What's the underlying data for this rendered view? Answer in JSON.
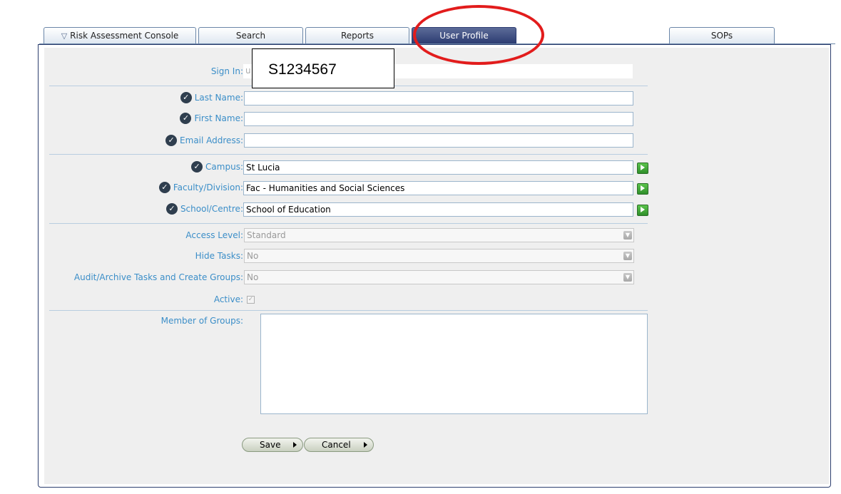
{
  "tabs": {
    "risk": "Risk Assessment Console",
    "search": "Search",
    "reports": "Reports",
    "profile": "User Profile",
    "sops": "SOPs"
  },
  "sign_in": {
    "label": "Sign In:",
    "value_prefix": "u"
  },
  "callout_text": "S1234567",
  "fields": {
    "last_name": {
      "label": "Last Name:",
      "value": ""
    },
    "first_name": {
      "label": "First Name:",
      "value": ""
    },
    "email": {
      "label": "Email Address:",
      "value": ""
    },
    "campus": {
      "label": "Campus:",
      "value": "St Lucia"
    },
    "faculty": {
      "label": "Faculty/Division:",
      "value": "Fac - Humanities and Social Sciences"
    },
    "school": {
      "label": "School/Centre:",
      "value": "School of Education"
    },
    "access_level": {
      "label": "Access Level:",
      "value": "Standard"
    },
    "hide_tasks": {
      "label": "Hide Tasks:",
      "value": "No"
    },
    "audit": {
      "label": "Audit/Archive Tasks and Create Groups:",
      "value": "No"
    },
    "active": {
      "label": "Active:",
      "checked": true
    },
    "groups": {
      "label": "Member of Groups:"
    }
  },
  "buttons": {
    "save": "Save",
    "cancel": "Cancel"
  },
  "icons": {
    "required": "check-circle-icon",
    "go": "green-arrow-icon",
    "dropdown": "chevron-down-icon",
    "tab_filter": "filter-triangle-icon"
  },
  "colors": {
    "active_tab": "#2a3a70",
    "label": "#3b8ec8",
    "highlight": "#e21c1c",
    "go_button": "#2f8f2a"
  }
}
